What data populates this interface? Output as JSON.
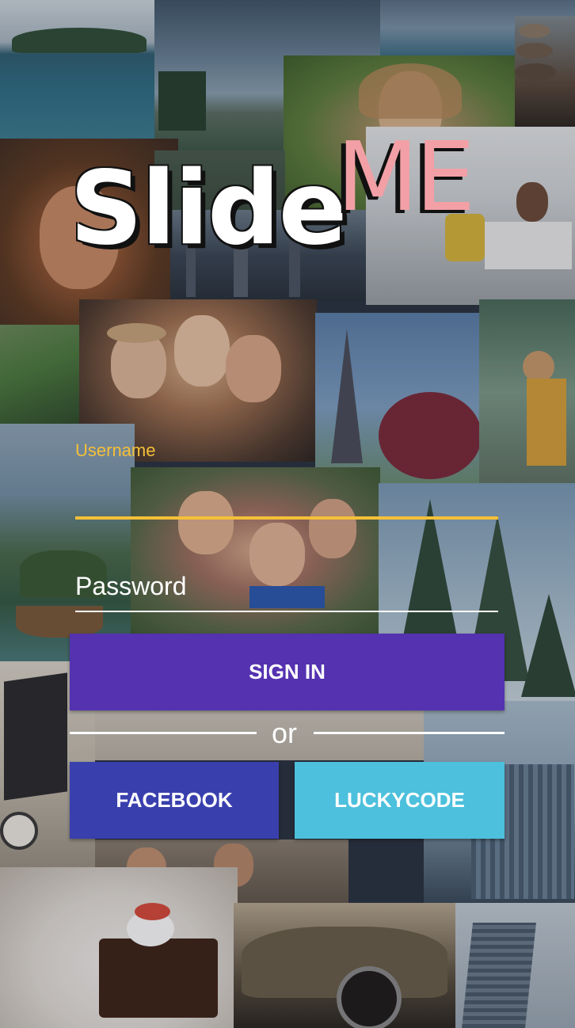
{
  "app": {
    "logo_primary": "Slide",
    "logo_accent": "ME"
  },
  "form": {
    "username_label": "Username",
    "username_value": "",
    "password_placeholder": "Password",
    "password_value": "",
    "sign_in_label": "SIGN IN",
    "or_label": "or",
    "facebook_label": "FACEBOOK",
    "luckycode_label": "LUCKYCODE"
  },
  "colors": {
    "accent_yellow": "#f5c038",
    "logo_pink": "#f2a0a6",
    "sign_in_purple": "#5432b0",
    "facebook_blue": "#3a3fae",
    "luckycode_cyan": "#4cc0dc"
  }
}
